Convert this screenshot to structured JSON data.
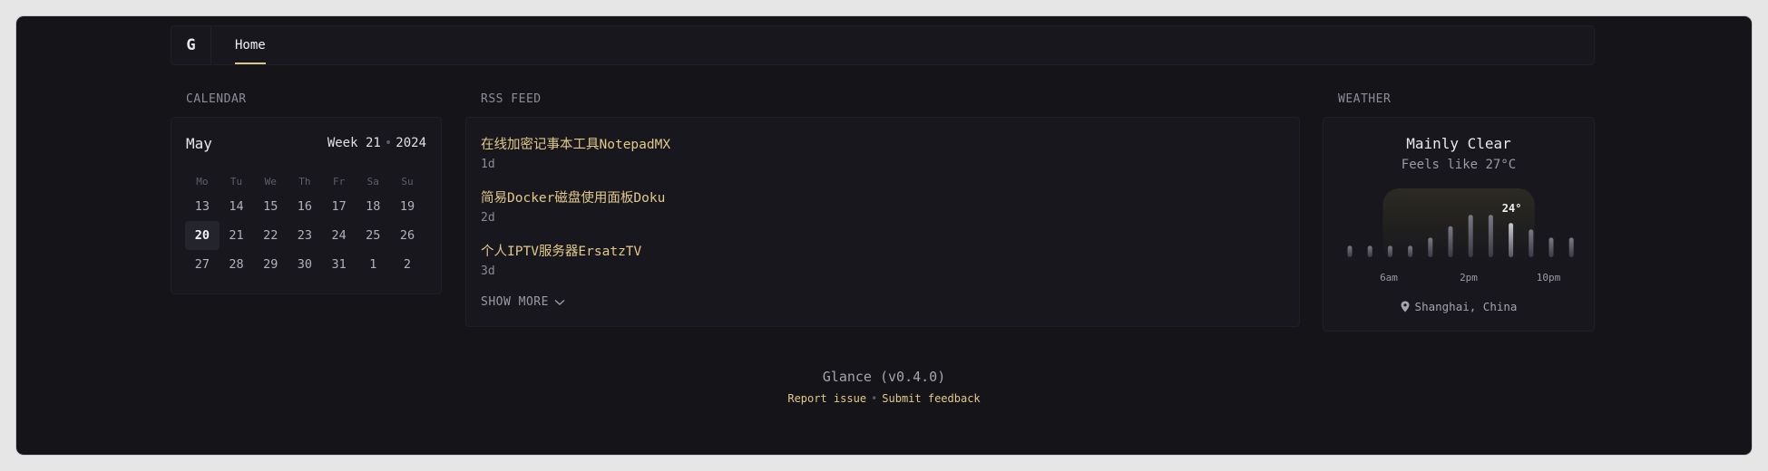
{
  "header": {
    "logo": "G",
    "nav": {
      "home_label": "Home"
    }
  },
  "calendar": {
    "section_title": "CALENDAR",
    "month": "May",
    "week_label": "Week 21",
    "year": "2024",
    "weekdays": [
      "Mo",
      "Tu",
      "We",
      "Th",
      "Fr",
      "Sa",
      "Su"
    ],
    "days": [
      "13",
      "14",
      "15",
      "16",
      "17",
      "18",
      "19",
      "20",
      "21",
      "22",
      "23",
      "24",
      "25",
      "26",
      "27",
      "28",
      "29",
      "30",
      "31",
      "1",
      "2"
    ],
    "today": "20"
  },
  "rss": {
    "section_title": "RSS FEED",
    "items": [
      {
        "title": "在线加密记事本工具NotepadMX",
        "age": "1d"
      },
      {
        "title": "简易Docker磁盘使用面板Doku",
        "age": "2d"
      },
      {
        "title": "个人IPTV服务器ErsatzTV",
        "age": "3d"
      }
    ],
    "show_more_label": "SHOW MORE"
  },
  "weather": {
    "section_title": "WEATHER",
    "condition": "Mainly Clear",
    "feels_like": "Feels like 27°C",
    "current_temp_label": "24°",
    "hour_labels": [
      "6am",
      "2pm",
      "10pm"
    ],
    "bar_levels": [
      0.14,
      0.14,
      0.14,
      0.14,
      0.24,
      0.38,
      0.52,
      0.52,
      0.42,
      0.34,
      0.24,
      0.24
    ],
    "current_index": 8,
    "location": "Shanghai, China",
    "colors": {
      "accent": "#e2c98a"
    }
  },
  "footer": {
    "app_name": "Glance (v0.4.0)",
    "report_label": "Report issue",
    "feedback_label": "Submit feedback"
  }
}
